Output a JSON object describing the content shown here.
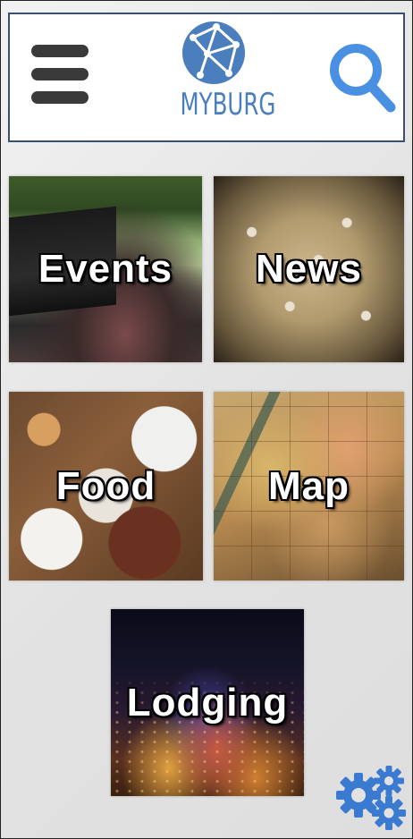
{
  "header": {
    "logo_text": "MYBURG",
    "menu_icon": "hamburger-menu-icon",
    "search_icon": "search-icon"
  },
  "tiles": [
    {
      "id": "events",
      "label": "Events"
    },
    {
      "id": "news",
      "label": "News"
    },
    {
      "id": "food",
      "label": "Food"
    },
    {
      "id": "map",
      "label": "Map"
    },
    {
      "id": "lodging",
      "label": "Lodging"
    }
  ],
  "settings": {
    "icon": "settings-gears-icon"
  },
  "colors": {
    "brand_blue": "#4a7ebc",
    "search_blue": "#4a90e2",
    "header_border": "#3a4f74",
    "menu_gray": "#3a3a3a"
  }
}
